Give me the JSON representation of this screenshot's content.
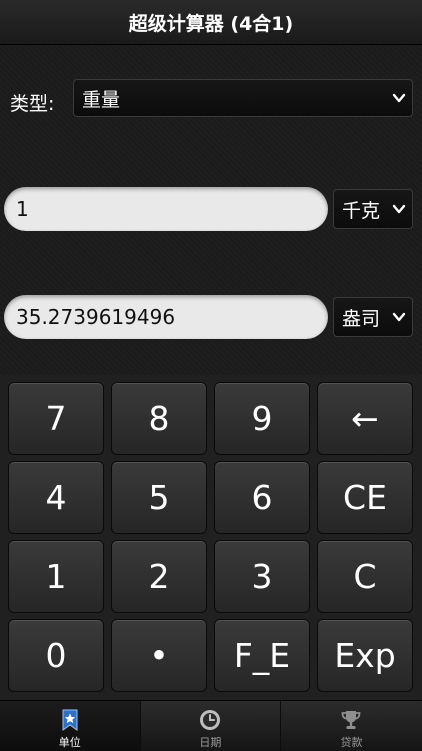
{
  "app": {
    "title": "超级计算器 (4合1)"
  },
  "converter": {
    "type_label": "类型:",
    "type_value": "重量",
    "input_value": "1",
    "input_unit": "千克",
    "output_value": "35.2739619496",
    "output_unit": "盎司"
  },
  "keypad": {
    "keys": [
      "7",
      "8",
      "9",
      "←",
      "4",
      "5",
      "6",
      "CE",
      "1",
      "2",
      "3",
      "C",
      "0",
      "•",
      "F_E",
      "Exp"
    ]
  },
  "tabs": [
    {
      "label": "单位",
      "icon": "star-icon",
      "active": true
    },
    {
      "label": "日期",
      "icon": "clock-icon",
      "active": false
    },
    {
      "label": "贷款",
      "icon": "trophy-icon",
      "active": false
    }
  ],
  "colors": {
    "background": "#1b1b1b",
    "key": "#333333",
    "field": "#e9e9e9"
  }
}
